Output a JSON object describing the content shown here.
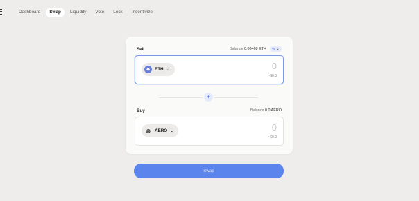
{
  "nav": {
    "items": [
      "Dashboard",
      "Swap",
      "Liquidity",
      "Vote",
      "Lock",
      "Incentivize"
    ],
    "active_index": 1
  },
  "sell": {
    "label": "Sell",
    "balance_label": "Balance",
    "balance_value": "0.00468 ETH",
    "max_label": "%",
    "token": "ETH",
    "token_icon": "eth-icon",
    "amount": "0",
    "usd": "~$0.0"
  },
  "buy": {
    "label": "Buy",
    "balance_label": "Balance",
    "balance_value": "0.0 AERO",
    "token": "AERO",
    "token_icon": "aero-icon",
    "amount": "0",
    "usd": "~$0.0"
  },
  "swap_direction_icon": "+",
  "swap_button": "Swap",
  "colors": {
    "accent": "#5b84ec",
    "background": "#eeedeb",
    "card": "#fafaf9"
  }
}
